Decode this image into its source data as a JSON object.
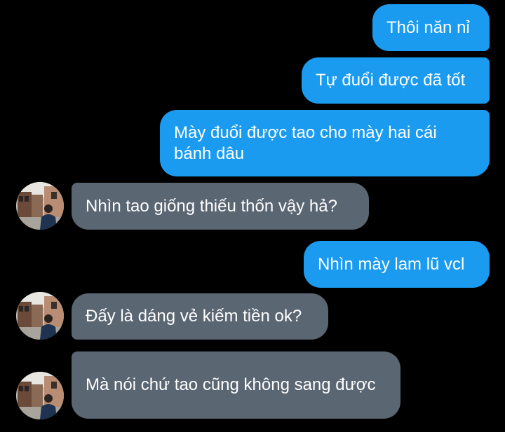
{
  "conversation": {
    "messages": [
      {
        "direction": "outgoing",
        "text": "Thôi năn nỉ"
      },
      {
        "direction": "outgoing",
        "text": "Tự đuổi được đã tốt"
      },
      {
        "direction": "outgoing",
        "text": "Mày đuổi được tao cho mày hai cái bánh dâu"
      },
      {
        "direction": "incoming",
        "text": "Nhìn tao giống thiếu thốn vậy hả?"
      },
      {
        "direction": "outgoing",
        "text": "Nhìn mày lam lũ vcl"
      },
      {
        "direction": "incoming",
        "text": "Đấy là dáng vẻ kiếm tiền ok?"
      },
      {
        "direction": "incoming",
        "text": "Mà nói chứ tao cũng không sang được"
      }
    ]
  },
  "colors": {
    "background": "#000000",
    "outgoing_bubble": "#1a9bf0",
    "incoming_bubble": "#5b6673",
    "text": "#ffffff"
  },
  "icons": {
    "avatar": "contact-avatar-photo"
  }
}
